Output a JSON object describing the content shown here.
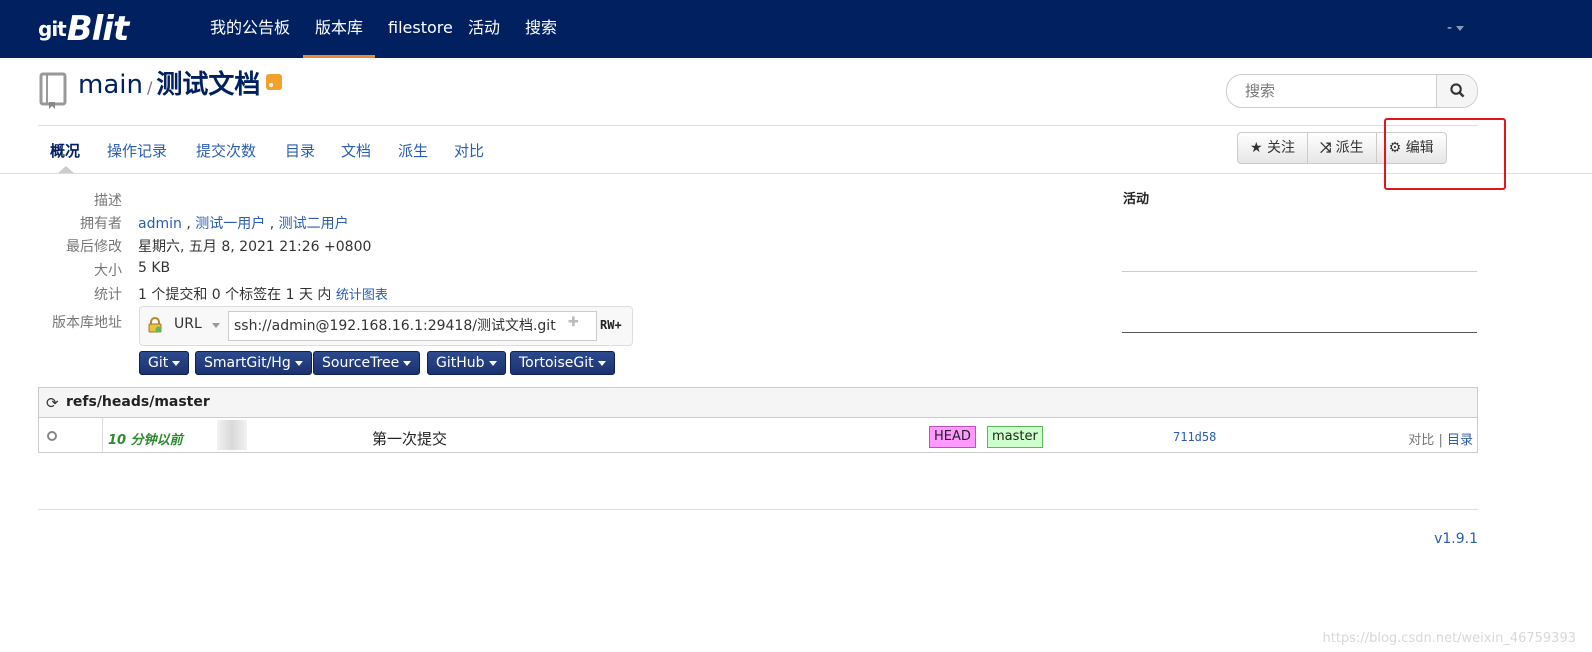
{
  "app": {
    "brand_prefix": "git",
    "brand": "Blit"
  },
  "nav": {
    "items": [
      {
        "label": "我的公告板",
        "active": false
      },
      {
        "label": "版本库",
        "active": true
      },
      {
        "label": "filestore",
        "active": false
      },
      {
        "label": "活动",
        "active": false
      },
      {
        "label": "搜索",
        "active": false
      }
    ],
    "user": "-"
  },
  "repo": {
    "project": "main",
    "separator": "/",
    "name": "测试文档",
    "icon": "repository-book-icon"
  },
  "search": {
    "placeholder": "搜索",
    "icon": "search-icon"
  },
  "tabs": [
    {
      "label": "概况",
      "active": true
    },
    {
      "label": "操作记录",
      "active": false
    },
    {
      "label": "提交次数",
      "active": false
    },
    {
      "label": "目录",
      "active": false
    },
    {
      "label": "文档",
      "active": false
    },
    {
      "label": "派生",
      "active": false
    },
    {
      "label": "对比",
      "active": false
    }
  ],
  "actions": {
    "watch": {
      "icon": "star-icon",
      "label": "关注"
    },
    "fork": {
      "icon": "shuffle-icon",
      "label": "派生"
    },
    "edit": {
      "icon": "gear-icon",
      "label": "编辑"
    }
  },
  "meta": {
    "description_label": "描述",
    "owner_label": "拥有者",
    "owners": [
      "admin",
      "测试一用户",
      "测试二用户"
    ],
    "owner_sep": ",",
    "modified_label": "最后修改",
    "modified_value": "星期六, 五月 8, 2021 21:26 +0800",
    "size_label": "大小",
    "size_value": "5 KB",
    "stats_label": "统计",
    "stats_value": "1 个提交和 0 个标签在 1 天 内",
    "stats_link": "统计图表",
    "url_label": "版本库地址",
    "url_type": "URL",
    "url_value": "ssh://admin@192.168.16.1:29418/测试文档.git",
    "url_permission": "RW+"
  },
  "clients": [
    "Git",
    "SmartGit/Hg",
    "SourceTree",
    "GitHub",
    "TortoiseGit"
  ],
  "activity": {
    "title": "活动"
  },
  "refs": {
    "title": "refs/heads/master",
    "commits": [
      {
        "time": "10 分钟以前",
        "message": "第一次提交",
        "refs": [
          "HEAD",
          "master"
        ],
        "id": "711d58",
        "link_compare": "对比",
        "link_sep": "|",
        "link_tree": "目录"
      }
    ]
  },
  "footer": {
    "version": "v1.9.1",
    "watermark": "https://blog.csdn.net/weixin_46759393"
  },
  "colors": {
    "navbar": "#002060",
    "nav_active": "#e98c2e",
    "link": "#2a5db0",
    "head_ref": "#ff99ff",
    "branch_ref": "#ccffcc",
    "highlight": "#e0161b"
  }
}
